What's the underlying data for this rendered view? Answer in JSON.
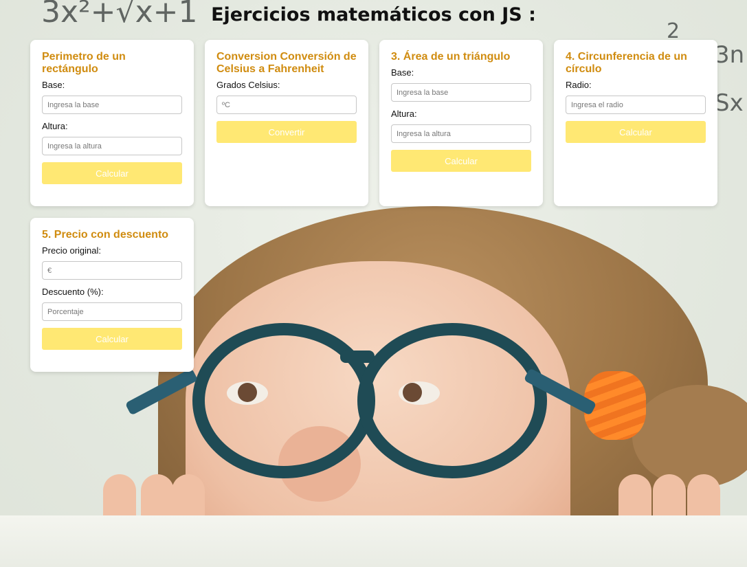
{
  "page_title": "Ejercicios matemáticos con JS :",
  "background_scribbles": [
    "3x²+√x+1",
    "3n",
    "Sx",
    "2"
  ],
  "cards": [
    {
      "title": "Perimetro de un rectángulo",
      "fields": [
        {
          "label": "Base:",
          "placeholder": "Ingresa la base"
        },
        {
          "label": "Altura:",
          "placeholder": "Ingresa la altura"
        }
      ],
      "button": "Calcular"
    },
    {
      "title": "Conversion Conversión de Celsius a Fahrenheit",
      "fields": [
        {
          "label": "Grados Celsius:",
          "placeholder": "ºC"
        }
      ],
      "button": "Convertir"
    },
    {
      "title": "3. Área de un triángulo",
      "fields": [
        {
          "label": "Base:",
          "placeholder": "Ingresa la base"
        },
        {
          "label": "Altura:",
          "placeholder": "Ingresa la altura"
        }
      ],
      "button": "Calcular"
    },
    {
      "title": "4. Circunferencia de un círculo",
      "fields": [
        {
          "label": "Radio:",
          "placeholder": "Ingresa el radio"
        }
      ],
      "button": "Calcular"
    },
    {
      "title": "5. Precio con descuento",
      "fields": [
        {
          "label": "Precio original:",
          "placeholder": "€"
        },
        {
          "label": "Descuento (%):",
          "placeholder": "Porcentaje"
        }
      ],
      "button": "Calcular"
    }
  ],
  "colors": {
    "card_title": "#d08c10",
    "button_bg": "#ffe873",
    "button_text": "#ffffff"
  }
}
